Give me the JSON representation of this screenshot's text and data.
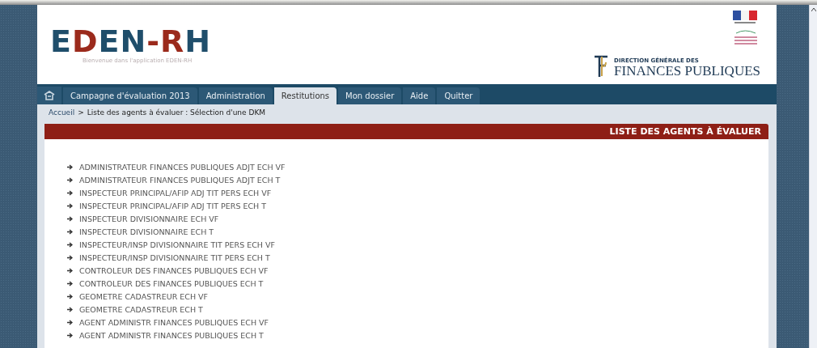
{
  "header": {
    "logo": {
      "parts": [
        {
          "text": "E",
          "color": "#1f4e6b"
        },
        {
          "text": "D",
          "color": "#9b2a1c"
        },
        {
          "text": "EN",
          "color": "#1f4e6b"
        },
        {
          "text": "-R",
          "color": "#9b2a1c"
        },
        {
          "text": "H",
          "color": "#1f4e6b"
        }
      ]
    },
    "subtitle": "Bienvenue dans l'application EDEN-RH",
    "dgfip": {
      "small": "DIRECTION GÉNÉRALE DES",
      "big": "FINANCES PUBLIQUES"
    }
  },
  "nav": {
    "tabs": [
      {
        "label": "Campagne d'évaluation 2013",
        "selected": false
      },
      {
        "label": "Administration",
        "selected": false
      },
      {
        "label": "Restitutions",
        "selected": true
      },
      {
        "label": "Mon dossier",
        "selected": false
      },
      {
        "label": "Aide",
        "selected": false
      },
      {
        "label": "Quitter",
        "selected": false
      }
    ]
  },
  "breadcrumb": {
    "link": "Accueil",
    "separator": ">",
    "current": "Liste des agents à évaluer : Sélection d'une DKM"
  },
  "section_title": "LISTE DES AGENTS À ÉVALUER",
  "items": [
    "ADMINISTRATEUR FINANCES PUBLIQUES ADJT ECH VF",
    "ADMINISTRATEUR FINANCES PUBLIQUES ADJT ECH T",
    "INSPECTEUR PRINCIPAL/AFIP ADJ TIT PERS ECH VF",
    "INSPECTEUR PRINCIPAL/AFIP ADJ TIT PERS ECH T",
    "INSPECTEUR DIVISIONNAIRE ECH VF",
    "INSPECTEUR DIVISIONNAIRE ECH T",
    "INSPECTEUR/INSP DIVISIONNAIRE TIT PERS ECH VF",
    "INSPECTEUR/INSP DIVISIONNAIRE TIT PERS ECH T",
    "CONTROLEUR DES FINANCES PUBLIQUES ECH VF",
    "CONTROLEUR DES FINANCES PUBLIQUES ECH T",
    "GEOMETRE CADASTREUR ECH VF",
    "GEOMETRE CADASTREUR ECH T",
    "AGENT ADMINISTR FINANCES PUBLIQUES ECH VF",
    "AGENT ADMINISTR FINANCES PUBLIQUES ECH T"
  ]
}
